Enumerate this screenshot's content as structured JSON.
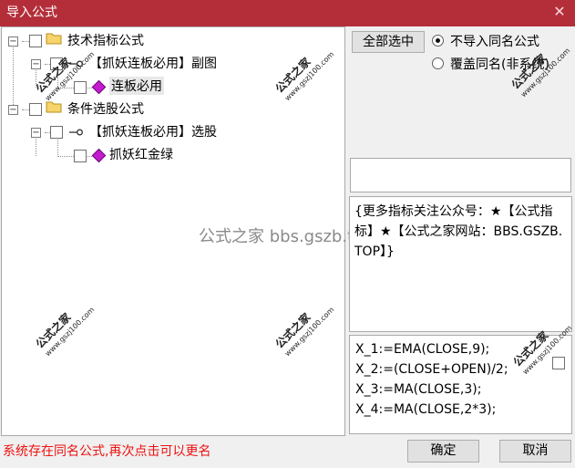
{
  "window": {
    "title": "导入公式",
    "close_glyph": "✕"
  },
  "tree": {
    "nodes": [
      {
        "label": "技术指标公式",
        "icon": "folder-icon"
      },
      {
        "label": "【抓妖连板必用】副图",
        "icon": "key-icon"
      },
      {
        "label": "连板必用",
        "icon": "gem-icon"
      },
      {
        "label": "条件选股公式",
        "icon": "folder-icon"
      },
      {
        "label": "【抓妖连板必用】选股",
        "icon": "key-icon"
      },
      {
        "label": "抓妖红金绿",
        "icon": "gem-icon"
      }
    ],
    "expander_minus": "−"
  },
  "controls": {
    "select_all_label": "全部选中",
    "radio_options": [
      {
        "label": "不导入同名公式",
        "selected": true
      },
      {
        "label": "覆盖同名(非系统)",
        "selected": false
      }
    ]
  },
  "info": {
    "text": "{更多指标关注公众号：★【公式指标】★【公式之家网站：BBS.GSZB.TOP】}"
  },
  "formula": {
    "lines": [
      "X_1:=EMA(CLOSE,9);",
      "X_2:=(CLOSE+OPEN)/2;",
      "X_3:=MA(CLOSE,3);",
      "X_4:=MA(CLOSE,2*3);"
    ]
  },
  "watermark": {
    "center_text": "公式之家 bbs.gszb.top",
    "stamp_text": "公式之家",
    "stamp_url": "www.gszj100.com"
  },
  "footer": {
    "status": "系统存在同名公式,再次点击可以更名",
    "ok_label": "确定",
    "cancel_label": "取消"
  },
  "colors": {
    "titlebar": "#b42e3a",
    "status_text": "#ee1111",
    "gem": "#c41bd1"
  }
}
